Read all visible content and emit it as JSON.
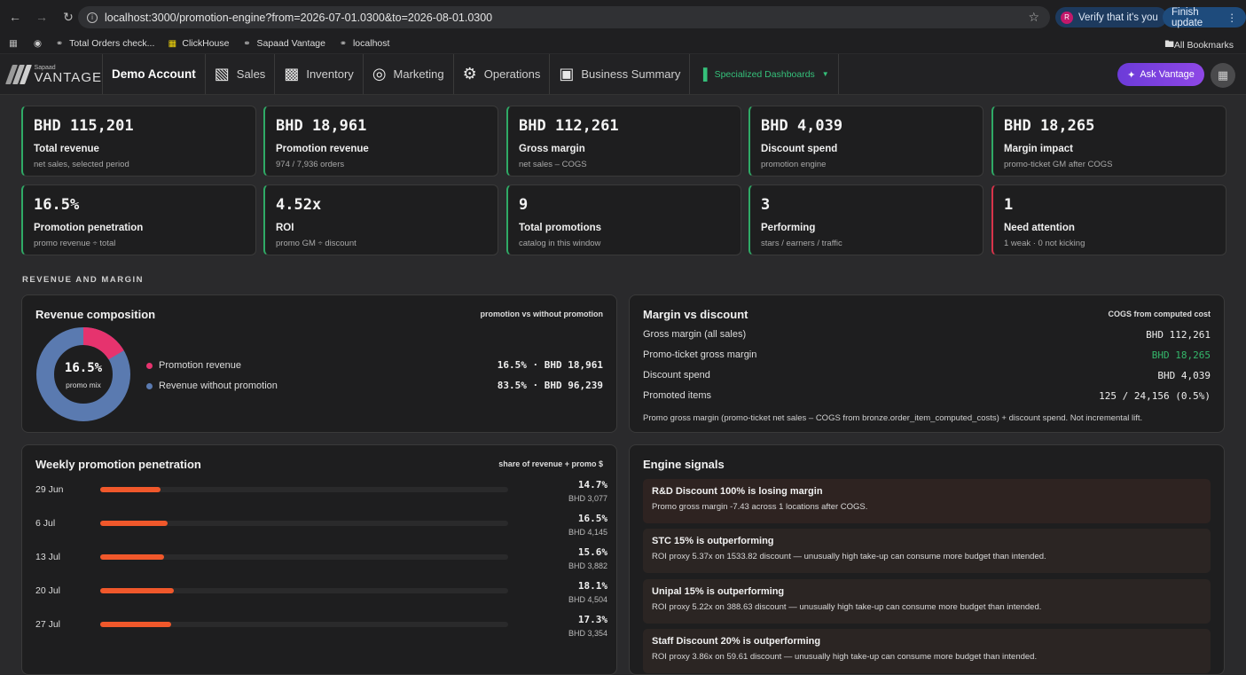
{
  "browser": {
    "url": "localhost:3000/promotion-engine?from=2026-07-01.0300&to=2026-08-01.0300",
    "verify_label": "Verify that it's you",
    "verify_avatar": "R",
    "finish_label": "Finish update",
    "bookmarks": [
      "Total Orders check...",
      "ClickHouse",
      "Sapaad Vantage",
      "localhost"
    ],
    "all_bookmarks": "All Bookmarks"
  },
  "app": {
    "logo_small": "Sapaad",
    "logo_big": "VANTAGE",
    "account": "Demo Account",
    "nav": [
      {
        "label": "Sales",
        "icon": "sales-icon"
      },
      {
        "label": "Inventory",
        "icon": "inventory-icon"
      },
      {
        "label": "Marketing",
        "icon": "target-icon"
      },
      {
        "label": "Operations",
        "icon": "gears-icon"
      },
      {
        "label": "Business Summary",
        "icon": "briefcase-icon"
      }
    ],
    "specialized": "Specialized Dashboards",
    "ask": "Ask Vantage"
  },
  "kpis": [
    {
      "value": "BHD 115,201",
      "label": "Total revenue",
      "sub": "net sales, selected period",
      "status": "green"
    },
    {
      "value": "BHD 18,961",
      "label": "Promotion revenue",
      "sub": "974 / 7,936 orders",
      "status": "green"
    },
    {
      "value": "BHD 112,261",
      "label": "Gross margin",
      "sub": "net sales – COGS",
      "status": "green"
    },
    {
      "value": "BHD 4,039",
      "label": "Discount spend",
      "sub": "promotion engine",
      "status": "green"
    },
    {
      "value": "BHD 18,265",
      "label": "Margin impact",
      "sub": "promo-ticket GM after COGS",
      "status": "green"
    },
    {
      "value": "16.5%",
      "label": "Promotion penetration",
      "sub": "promo revenue ÷ total",
      "status": "green"
    },
    {
      "value": "4.52x",
      "label": "ROI",
      "sub": "promo GM ÷ discount",
      "status": "green"
    },
    {
      "value": "9",
      "label": "Total promotions",
      "sub": "catalog in this window",
      "status": "green"
    },
    {
      "value": "3",
      "label": "Performing",
      "sub": "stars / earners / traffic",
      "status": "green"
    },
    {
      "value": "1",
      "label": "Need attention",
      "sub": "1 weak · 0 not kicking",
      "status": "red"
    }
  ],
  "section_title": "REVENUE AND MARGIN",
  "composition": {
    "title": "Revenue composition",
    "note": "promotion vs without promotion",
    "center_value": "16.5%",
    "center_label": "promo mix",
    "promo_fraction": 0.165,
    "colors": {
      "promo": "#e6336e",
      "other": "#5a7ab0"
    },
    "rows": [
      {
        "label": "Promotion revenue",
        "value": "16.5% · BHD 18,961"
      },
      {
        "label": "Revenue without promotion",
        "value": "83.5% · BHD 96,239"
      }
    ]
  },
  "margin": {
    "title": "Margin vs discount",
    "note": "COGS from computed cost",
    "rows": [
      {
        "label": "Gross margin (all sales)",
        "value": "BHD 112,261"
      },
      {
        "label": "Promo-ticket gross margin",
        "value": "BHD 18,265"
      },
      {
        "label": "Discount spend",
        "value": "BHD 4,039"
      },
      {
        "label": "Promoted items",
        "value": "125 / 24,156 (0.5%)"
      }
    ],
    "footnote": "Promo gross margin (promo-ticket net sales – COGS from bronze.order_item_computed_costs) + discount spend. Not incremental lift."
  },
  "weekly": {
    "title": "Weekly promotion penetration",
    "note": "share of revenue + promo $",
    "max_pct": 100,
    "rows": [
      {
        "week": "29 Jun",
        "pct_value": 14.7,
        "pct": "14.7%",
        "amount": "BHD 3,077"
      },
      {
        "week": "6 Jul",
        "pct_value": 16.5,
        "pct": "16.5%",
        "amount": "BHD 4,145"
      },
      {
        "week": "13 Jul",
        "pct_value": 15.6,
        "pct": "15.6%",
        "amount": "BHD 3,882"
      },
      {
        "week": "20 Jul",
        "pct_value": 18.1,
        "pct": "18.1%",
        "amount": "BHD 4,504"
      },
      {
        "week": "27 Jul",
        "pct_value": 17.3,
        "pct": "17.3%",
        "amount": "BHD 3,354"
      }
    ]
  },
  "signals": {
    "title": "Engine signals",
    "items": [
      {
        "title": "R&D Discount 100% is losing margin",
        "desc": "Promo gross margin -7.43 across 1 locations after COGS.",
        "kind": "bad"
      },
      {
        "title": "STC 15% is outperforming",
        "desc": "ROI proxy 5.37x on 1533.82 discount — unusually high take-up can consume more budget than intended.",
        "kind": "warn"
      },
      {
        "title": "Unipal 15% is outperforming",
        "desc": "ROI proxy 5.22x on 388.63 discount — unusually high take-up can consume more budget than intended.",
        "kind": "warn"
      },
      {
        "title": "Staff Discount 20% is outperforming",
        "desc": "ROI proxy 3.86x on 59.61 discount — unusually high take-up can consume more budget than intended.",
        "kind": "warn"
      }
    ]
  }
}
